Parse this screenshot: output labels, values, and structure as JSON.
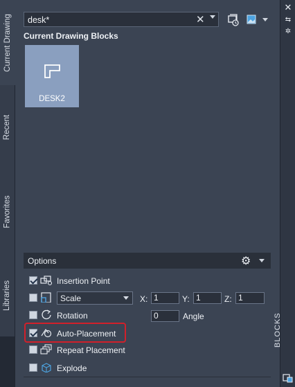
{
  "left_tabs": [
    {
      "label": "Current Drawing",
      "active": true
    },
    {
      "label": "Recent",
      "active": false
    },
    {
      "label": "Favorites",
      "active": false
    },
    {
      "label": "Libraries",
      "active": false
    }
  ],
  "search": {
    "value": "desk*"
  },
  "section_title": "Current Drawing Blocks",
  "blocks": [
    {
      "name": "DESK2"
    }
  ],
  "options": {
    "title": "Options",
    "insertion_point": {
      "label": "Insertion Point",
      "checked": true
    },
    "scale": {
      "checked": false,
      "selected": "Scale",
      "x_label": "X:",
      "x_value": "1",
      "y_label": "Y:",
      "y_value": "1",
      "z_label": "Z:",
      "z_value": "1"
    },
    "rotation": {
      "label": "Rotation",
      "checked": false,
      "angle_value": "0",
      "angle_label": "Angle"
    },
    "auto_placement": {
      "label": "Auto-Placement",
      "checked": true
    },
    "repeat_placement": {
      "label": "Repeat Placement",
      "checked": false
    },
    "explode": {
      "label": "Explode",
      "checked": false
    }
  },
  "right_bar": {
    "palette_label": "BLOCKS"
  },
  "colors": {
    "highlight": "#d2202a",
    "tile": "#8a9fbf",
    "panel": "#3b4453"
  }
}
